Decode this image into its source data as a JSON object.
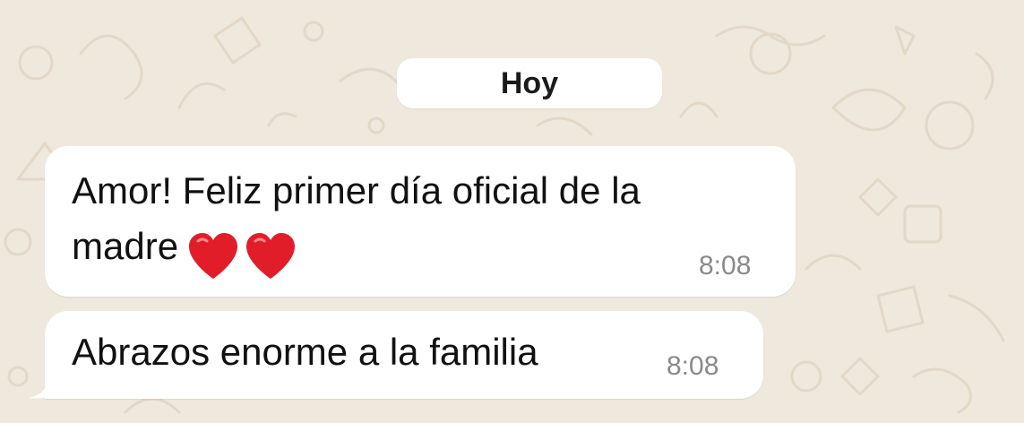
{
  "chat": {
    "date_separator": "Hoy",
    "messages": [
      {
        "text_line1": "Amor! Feliz primer día oficial de la",
        "text_line2": "madre",
        "emoji": [
          "heart",
          "heart"
        ],
        "time": "8:08"
      },
      {
        "text": "Abrazos enorme a la familia",
        "time": "8:08"
      }
    ]
  },
  "colors": {
    "background": "#efe8dc",
    "bubble": "#ffffff",
    "text": "#111111",
    "time": "#8a8a8a",
    "heart": "#e11d2a"
  }
}
